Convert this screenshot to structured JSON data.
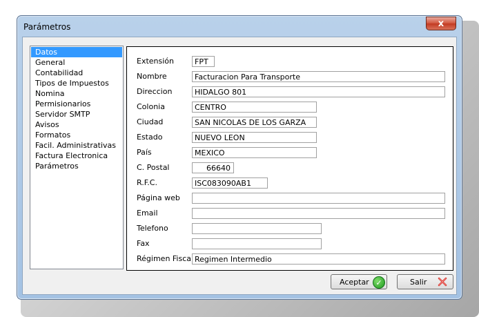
{
  "window": {
    "title": "Parámetros",
    "close_glyph": "x"
  },
  "nav": {
    "items": [
      {
        "label": "Datos",
        "selected": true
      },
      {
        "label": "General"
      },
      {
        "label": "Contabilidad"
      },
      {
        "label": "Tipos de Impuestos"
      },
      {
        "label": "Nomina"
      },
      {
        "label": "Permisionarios"
      },
      {
        "label": "Servidor SMTP"
      },
      {
        "label": "Avisos"
      },
      {
        "label": "Formatos"
      },
      {
        "label": "Facil. Administrativas"
      },
      {
        "label": "Factura Electronica"
      },
      {
        "label": "Parámetros"
      }
    ]
  },
  "form": {
    "extension": {
      "label": "Extensión",
      "value": "FPT"
    },
    "nombre": {
      "label": "Nombre",
      "value": "Facturacion Para Transporte"
    },
    "direccion": {
      "label": "Direccion",
      "value": "HIDALGO 801"
    },
    "colonia": {
      "label": "Colonia",
      "value": "CENTRO"
    },
    "ciudad": {
      "label": "Ciudad",
      "value": "SAN NICOLAS DE LOS GARZA"
    },
    "estado": {
      "label": "Estado",
      "value": "NUEVO LEON"
    },
    "pais": {
      "label": "País",
      "value": "MEXICO"
    },
    "cpostal": {
      "label": "C. Postal",
      "value": "66640"
    },
    "rfc": {
      "label": "R.F.C.",
      "value": "ISC083090AB1"
    },
    "pagina_web": {
      "label": "Página web",
      "value": ""
    },
    "email": {
      "label": "Email",
      "value": ""
    },
    "telefono": {
      "label": "Telefono",
      "value": ""
    },
    "fax": {
      "label": "Fax",
      "value": ""
    },
    "regimen": {
      "label": "Régimen Fiscal",
      "value": "Regimen Intermedio"
    }
  },
  "buttons": {
    "accept": {
      "label": "Aceptar",
      "icon": "check-circle-icon"
    },
    "exit": {
      "label": "Salir",
      "icon": "red-x-icon"
    }
  },
  "colors": {
    "selection": "#3399ff",
    "close_button": "#c23a22",
    "accept_icon": "#1e9a1e",
    "exit_icon": "#d9302a"
  }
}
